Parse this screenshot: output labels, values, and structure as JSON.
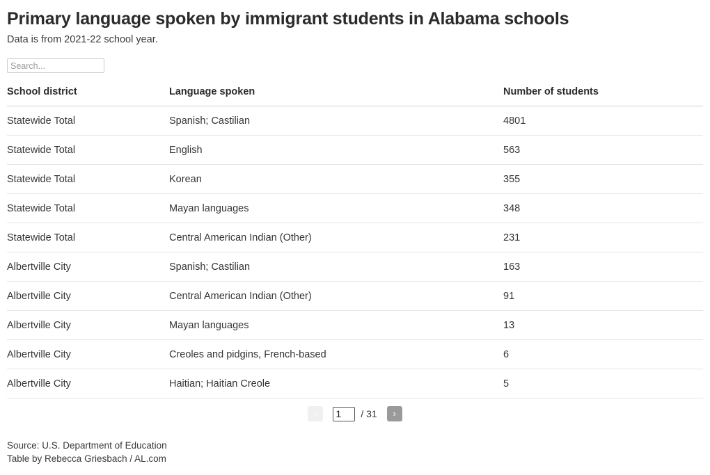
{
  "header": {
    "title": "Primary language spoken by immigrant students in Alabama schools",
    "subtitle": "Data is from 2021-22 school year."
  },
  "search": {
    "placeholder": "Search...",
    "value": ""
  },
  "table": {
    "columns": [
      "School district",
      "Language spoken",
      "Number of students"
    ],
    "rows": [
      {
        "district": "Statewide Total",
        "language": "Spanish; Castilian",
        "students": "4801"
      },
      {
        "district": "Statewide Total",
        "language": "English",
        "students": "563"
      },
      {
        "district": "Statewide Total",
        "language": "Korean",
        "students": "355"
      },
      {
        "district": "Statewide Total",
        "language": "Mayan languages",
        "students": "348"
      },
      {
        "district": "Statewide Total",
        "language": "Central American Indian (Other)",
        "students": "231"
      },
      {
        "district": "Albertville City",
        "language": "Spanish; Castilian",
        "students": "163"
      },
      {
        "district": "Albertville City",
        "language": "Central American Indian (Other)",
        "students": "91"
      },
      {
        "district": "Albertville City",
        "language": "Mayan languages",
        "students": "13"
      },
      {
        "district": "Albertville City",
        "language": "Creoles and pidgins, French-based",
        "students": "6"
      },
      {
        "district": "Albertville City",
        "language": "Haitian; Haitian Creole",
        "students": "5"
      }
    ]
  },
  "pagination": {
    "prev_label": "‹",
    "next_label": "›",
    "current_page": "1",
    "total_pages_label": "/ 31"
  },
  "footer": {
    "source": "Source: U.S. Department of Education",
    "credit": "Table by Rebecca Griesbach / AL.com"
  },
  "colors": {
    "title": "#2b2b2b",
    "text": "#343434",
    "row_border": "#e6e6e6",
    "header_border": "#d0d0d0",
    "next_button": "#9a9a9a",
    "prev_button_disabled": "#f0f0f0"
  }
}
